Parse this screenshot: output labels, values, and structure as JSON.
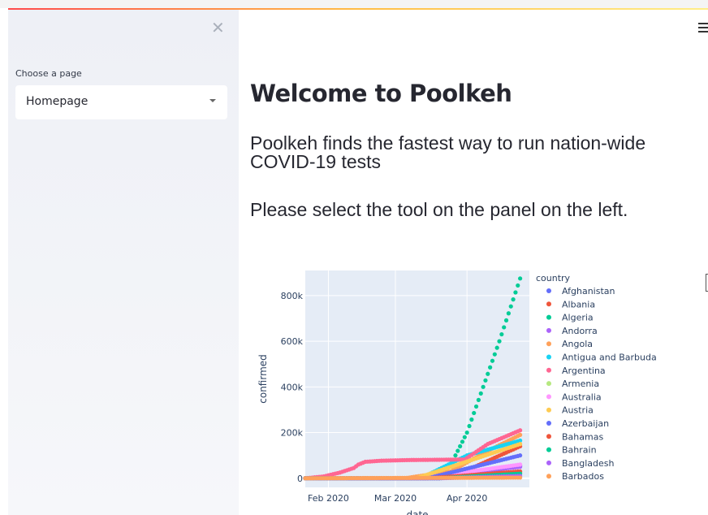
{
  "sidebar": {
    "select_label": "Choose a page",
    "select_value": "Homepage",
    "close_icon": "close-icon"
  },
  "main": {
    "title": "Welcome to Poolkeh",
    "lead": "Poolkeh finds the fastest way to run nation-wide COVID-19 tests",
    "instruction": "Please select the tool on the panel on the left."
  },
  "chart_data": {
    "type": "scatter",
    "xlabel": "date",
    "ylabel": "confirmed",
    "x_range": [
      "2020-01-22",
      "2020-04-28"
    ],
    "ylim": [
      -40000,
      910000
    ],
    "x_ticks": [
      {
        "date": "2020-02-01",
        "label": "Feb 2020"
      },
      {
        "date": "2020-03-01",
        "label": "Mar 2020"
      },
      {
        "date": "2020-04-01",
        "label": "Apr 2020"
      }
    ],
    "y_ticks": [
      {
        "value": 0,
        "label": "0"
      },
      {
        "value": 200000,
        "label": "200k"
      },
      {
        "value": 400000,
        "label": "400k"
      },
      {
        "value": 600000,
        "label": "600k"
      },
      {
        "value": 800000,
        "label": "800k"
      }
    ],
    "legend_title": "country",
    "legend_position": "right",
    "series": [
      {
        "name": "Afghanistan",
        "color": "#636efa",
        "points": [
          [
            "2020-01-22",
            0
          ],
          [
            "2020-03-20",
            0
          ],
          [
            "2020-04-10",
            30000
          ],
          [
            "2020-04-24",
            55000
          ]
        ]
      },
      {
        "name": "Albania",
        "color": "#ef553b",
        "points": [
          [
            "2020-01-22",
            0
          ],
          [
            "2020-03-10",
            0
          ],
          [
            "2020-04-01",
            35000
          ],
          [
            "2020-04-24",
            140000
          ]
        ]
      },
      {
        "name": "Algeria",
        "color": "#00cc96",
        "points": [
          [
            "2020-01-22",
            0
          ],
          [
            "2020-03-08",
            0
          ],
          [
            "2020-03-18",
            10000
          ],
          [
            "2020-03-25",
            60000
          ],
          [
            "2020-04-01",
            200000
          ],
          [
            "2020-04-08",
            400000
          ],
          [
            "2020-04-15",
            600000
          ],
          [
            "2020-04-24",
            875000
          ]
        ]
      },
      {
        "name": "Andorra",
        "color": "#ab63fa",
        "points": [
          [
            "2020-01-22",
            0
          ],
          [
            "2020-03-15",
            0
          ],
          [
            "2020-04-10",
            35000
          ],
          [
            "2020-04-24",
            50000
          ]
        ]
      },
      {
        "name": "Angola",
        "color": "#ffa15a",
        "points": [
          [
            "2020-01-22",
            0
          ],
          [
            "2020-03-05",
            0
          ],
          [
            "2020-03-25",
            30000
          ],
          [
            "2020-04-10",
            120000
          ],
          [
            "2020-04-24",
            190000
          ]
        ]
      },
      {
        "name": "Antigua and Barbuda",
        "color": "#19d3f3",
        "points": [
          [
            "2020-01-22",
            0
          ],
          [
            "2020-03-12",
            0
          ],
          [
            "2020-04-01",
            100000
          ],
          [
            "2020-04-24",
            165000
          ]
        ]
      },
      {
        "name": "Argentina",
        "color": "#ff6692",
        "points": [
          [
            "2020-01-22",
            0
          ],
          [
            "2020-01-30",
            8000
          ],
          [
            "2020-02-06",
            25000
          ],
          [
            "2020-02-12",
            45000
          ],
          [
            "2020-02-14",
            60000
          ],
          [
            "2020-02-17",
            72000
          ],
          [
            "2020-02-24",
            77000
          ],
          [
            "2020-03-08",
            80000
          ],
          [
            "2020-03-31",
            82000
          ],
          [
            "2020-04-10",
            150000
          ],
          [
            "2020-04-24",
            210000
          ]
        ]
      },
      {
        "name": "Armenia",
        "color": "#b6e880",
        "points": [
          [
            "2020-01-22",
            0
          ],
          [
            "2020-03-10",
            0
          ],
          [
            "2020-04-24",
            25000
          ]
        ]
      },
      {
        "name": "Australia",
        "color": "#ff97ff",
        "points": [
          [
            "2020-01-22",
            0
          ],
          [
            "2020-03-12",
            0
          ],
          [
            "2020-04-24",
            60000
          ]
        ]
      },
      {
        "name": "Austria",
        "color": "#fecb52",
        "points": [
          [
            "2020-01-22",
            0
          ],
          [
            "2020-03-10",
            0
          ],
          [
            "2020-04-24",
            150000
          ]
        ]
      },
      {
        "name": "Azerbaijan",
        "color": "#636efa",
        "points": [
          [
            "2020-01-22",
            0
          ],
          [
            "2020-03-15",
            0
          ],
          [
            "2020-04-24",
            100000
          ]
        ]
      },
      {
        "name": "Bahamas",
        "color": "#ef553b",
        "points": [
          [
            "2020-01-22",
            0
          ],
          [
            "2020-03-15",
            0
          ],
          [
            "2020-04-24",
            30000
          ]
        ]
      },
      {
        "name": "Bahrain",
        "color": "#00cc96",
        "points": [
          [
            "2020-01-22",
            0
          ],
          [
            "2020-03-20",
            0
          ],
          [
            "2020-04-24",
            20000
          ]
        ]
      },
      {
        "name": "Bangladesh",
        "color": "#ab63fa",
        "points": [
          [
            "2020-01-22",
            0
          ],
          [
            "2020-03-20",
            0
          ],
          [
            "2020-04-24",
            10000
          ]
        ]
      },
      {
        "name": "Barbados",
        "color": "#ffa15a",
        "points": [
          [
            "2020-01-22",
            0
          ],
          [
            "2020-04-24",
            3000
          ]
        ]
      }
    ]
  }
}
